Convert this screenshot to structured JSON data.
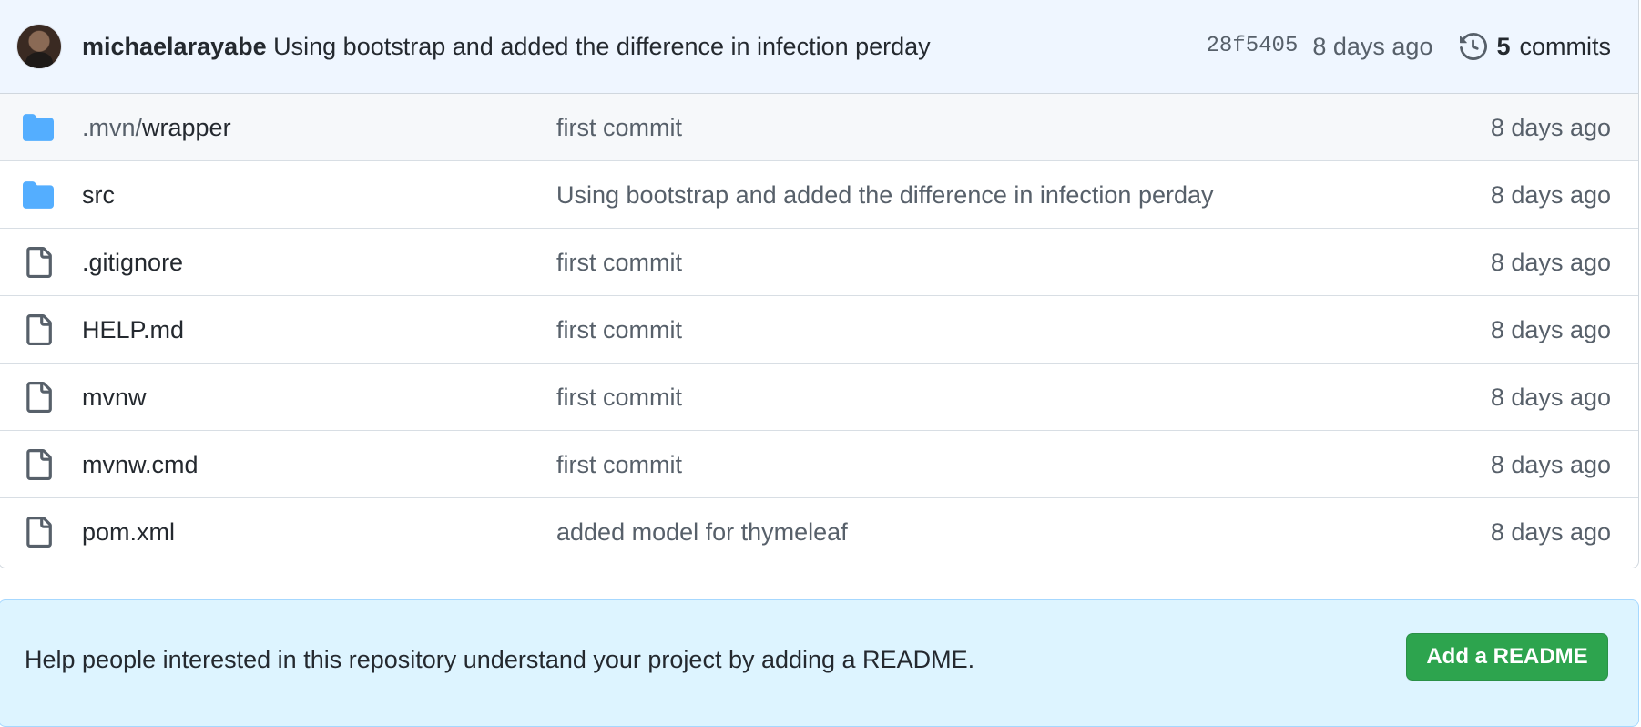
{
  "commit": {
    "author": "michaelarayabe",
    "message": "Using bootstrap and added the difference in infection perday",
    "sha": "28f5405",
    "age": "8 days ago",
    "commits_count": "5",
    "commits_label": "commits"
  },
  "files": [
    {
      "type": "folder",
      "prefix": ".mvn/",
      "name": "wrapper",
      "message": "first commit",
      "age": "8 days ago"
    },
    {
      "type": "folder",
      "prefix": "",
      "name": "src",
      "message": "Using bootstrap and added the difference in infection perday",
      "age": "8 days ago"
    },
    {
      "type": "file",
      "prefix": "",
      "name": ".gitignore",
      "message": "first commit",
      "age": "8 days ago"
    },
    {
      "type": "file",
      "prefix": "",
      "name": "HELP.md",
      "message": "first commit",
      "age": "8 days ago"
    },
    {
      "type": "file",
      "prefix": "",
      "name": "mvnw",
      "message": "first commit",
      "age": "8 days ago"
    },
    {
      "type": "file",
      "prefix": "",
      "name": "mvnw.cmd",
      "message": "first commit",
      "age": "8 days ago"
    },
    {
      "type": "file",
      "prefix": "",
      "name": "pom.xml",
      "message": "added model for thymeleaf",
      "age": "8 days ago"
    }
  ],
  "readme": {
    "text": "Help people interested in this repository understand your project by adding a README.",
    "button_label": "Add a README"
  },
  "colors": {
    "folder": "#54aeff",
    "file_icon": "#57606a",
    "button": "#2da44e"
  }
}
